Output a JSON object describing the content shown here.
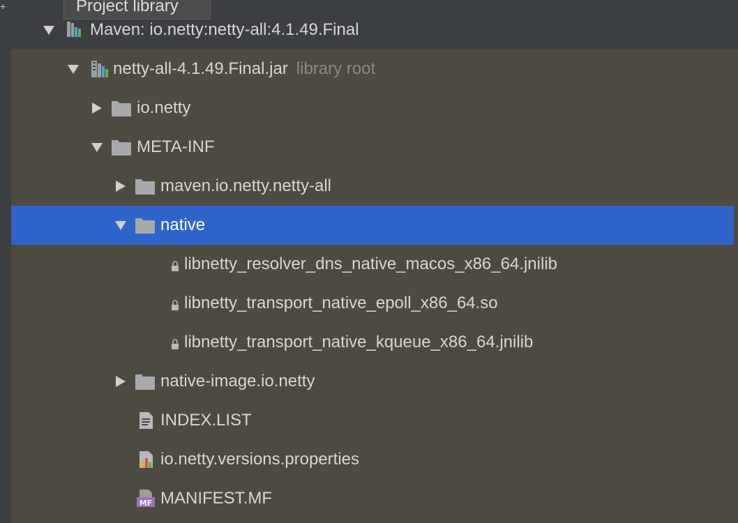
{
  "tooltip": {
    "text": "Project library"
  },
  "tree": {
    "maven_root": {
      "label": "Maven: io.netty:netty-all:4.1.49.Final",
      "expanded": true
    },
    "jar": {
      "label": "netty-all-4.1.49.Final.jar",
      "hint": "library root",
      "expanded": true
    },
    "io_netty": {
      "label": "io.netty",
      "expanded": false
    },
    "meta_inf": {
      "label": "META-INF",
      "expanded": true
    },
    "maven_pkg": {
      "label": "maven.io.netty.netty-all",
      "expanded": false
    },
    "native": {
      "label": "native",
      "expanded": true,
      "selected": true
    },
    "files_native": [
      {
        "label": "libnetty_resolver_dns_native_macos_x86_64.jnilib"
      },
      {
        "label": "libnetty_transport_native_epoll_x86_64.so"
      },
      {
        "label": "libnetty_transport_native_kqueue_x86_64.jnilib"
      }
    ],
    "native_image": {
      "label": "native-image.io.netty",
      "expanded": false
    },
    "index_list": {
      "label": "INDEX.LIST"
    },
    "versions_props": {
      "label": "io.netty.versions.properties"
    },
    "manifest": {
      "label": "MANIFEST.MF",
      "icon_text": "MF"
    }
  },
  "colors": {
    "selection": "#2f65ca",
    "panel_dark": "#3c3f41",
    "tree_bg": "#4d4a3f",
    "text": "#d6d6d6",
    "hint": "#8b8b85"
  }
}
